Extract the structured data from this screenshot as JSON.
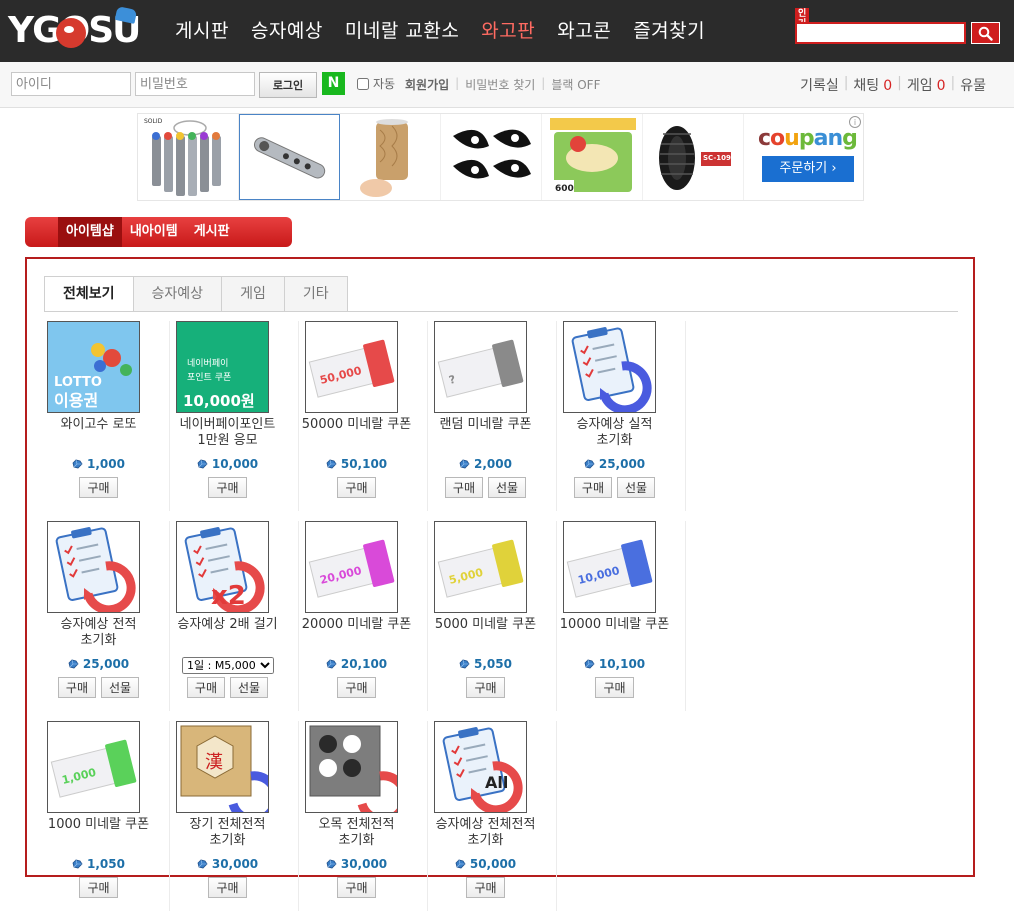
{
  "brand": {
    "logo_text": "YGOSU"
  },
  "gnb": [
    {
      "label": "게시판"
    },
    {
      "label": "승자예상"
    },
    {
      "label": "미네랄 교환소"
    },
    {
      "label": "와고판",
      "active": true
    },
    {
      "label": "와고콘"
    },
    {
      "label": "즐겨찾기"
    }
  ],
  "search": {
    "popular_tag": "인기",
    "value": ""
  },
  "login": {
    "id_placeholder": "아이디",
    "pw_placeholder": "비밀번호",
    "login_label": "로그인",
    "naver_label": "N",
    "auto_label": "자동",
    "links": [
      {
        "label": "회원가입",
        "bold": true
      },
      {
        "label": "비밀번호 찾기"
      },
      {
        "label": "블랙 OFF"
      }
    ]
  },
  "right_links": [
    {
      "label": "기록실"
    },
    {
      "label": "채팅",
      "count": "0"
    },
    {
      "label": "게임",
      "count": "0"
    },
    {
      "label": "유물"
    }
  ],
  "ad": {
    "coupang_logo": "coupang",
    "coupang_button": "주문하기 ›",
    "info": "i",
    "items": [
      {
        "name": "solid-key-tools"
      },
      {
        "name": "wrench-ratchet"
      },
      {
        "name": "wood-tumbler"
      },
      {
        "name": "eyes-sticker"
      },
      {
        "name": "snack-bread",
        "badge": "600"
      },
      {
        "name": "tire",
        "badge": "SC-109"
      }
    ]
  },
  "subtabs": [
    {
      "label": "아이템샵",
      "active": true
    },
    {
      "label": "내아이템"
    },
    {
      "label": "게시판"
    }
  ],
  "category_tabs": [
    {
      "label": "전체보기",
      "active": true
    },
    {
      "label": "승자예상"
    },
    {
      "label": "게임"
    },
    {
      "label": "기타"
    }
  ],
  "colors": {
    "accent_red": "#cf1e1e",
    "price_blue": "#1d6fa8",
    "box_border": "#b51d1d"
  },
  "items": [
    {
      "name": "와이고수 로또",
      "price": "1,000",
      "buttons": [
        "구매"
      ],
      "thumb": "lotto",
      "thumb_text": [
        "LOTTO",
        "이용권"
      ]
    },
    {
      "name": "네이버페이포인트 1만원 응모",
      "price": "10,000",
      "buttons": [
        "구매"
      ],
      "thumb": "naverpay",
      "thumb_text": [
        "네이버페이",
        "포인트 쿠폰",
        "10,000원"
      ]
    },
    {
      "name": "50000 미네랄 쿠폰",
      "price": "50,100",
      "buttons": [
        "구매"
      ],
      "thumb": "coupon",
      "thumb_text": [
        "50,000"
      ],
      "color": "#e64a4a"
    },
    {
      "name": "랜덤 미네랄 쿠폰",
      "price": "2,000",
      "buttons": [
        "구매",
        "선물"
      ],
      "thumb": "coupon",
      "thumb_text": [
        "?"
      ],
      "color": "#8a8a8a"
    },
    {
      "name": "승자예상 실적 초기화",
      "price": "25,000",
      "buttons": [
        "구매",
        "선물"
      ],
      "thumb": "clip",
      "color": "#4a5bdf"
    },
    {
      "name": "승자예상 전적 초기화",
      "price": "25,000",
      "buttons": [
        "구매",
        "선물"
      ],
      "thumb": "clip",
      "color": "#e64a4a"
    },
    {
      "name": "승자예상 2배 걸기",
      "price": null,
      "buttons": [
        "구매",
        "선물"
      ],
      "thumb": "clip-x2",
      "thumb_text": [
        "x2"
      ],
      "color": "#e64a4a",
      "select_value": "1일 : M5,000"
    },
    {
      "name": "20000 미네랄 쿠폰",
      "price": "20,100",
      "buttons": [
        "구매"
      ],
      "thumb": "coupon",
      "thumb_text": [
        "20,000"
      ],
      "color": "#d94ad9"
    },
    {
      "name": "5000 미네랄 쿠폰",
      "price": "5,050",
      "buttons": [
        "구매"
      ],
      "thumb": "coupon",
      "thumb_text": [
        "5,000"
      ],
      "color": "#e0d23a"
    },
    {
      "name": "10000 미네랄 쿠폰",
      "price": "10,100",
      "buttons": [
        "구매"
      ],
      "thumb": "coupon",
      "thumb_text": [
        "10,000"
      ],
      "color": "#4a6fdf"
    },
    {
      "name": "1000 미네랄 쿠폰",
      "price": "1,050",
      "buttons": [
        "구매"
      ],
      "thumb": "coupon",
      "thumb_text": [
        "1,000"
      ],
      "color": "#5ad15a"
    },
    {
      "name": "장기 전체전적 초기화",
      "price": "30,000",
      "buttons": [
        "구매"
      ],
      "thumb": "janggi",
      "thumb_text": [
        "漢"
      ],
      "color": "#4a5bdf"
    },
    {
      "name": "오목 전체전적 초기화",
      "price": "30,000",
      "buttons": [
        "구매"
      ],
      "thumb": "omok",
      "color": "#e64a4a"
    },
    {
      "name": "승자예상 전체전적 초기화",
      "price": "50,000",
      "buttons": [
        "구매"
      ],
      "thumb": "clip-all",
      "thumb_text": [
        "All"
      ],
      "color": "#e64a4a"
    }
  ]
}
